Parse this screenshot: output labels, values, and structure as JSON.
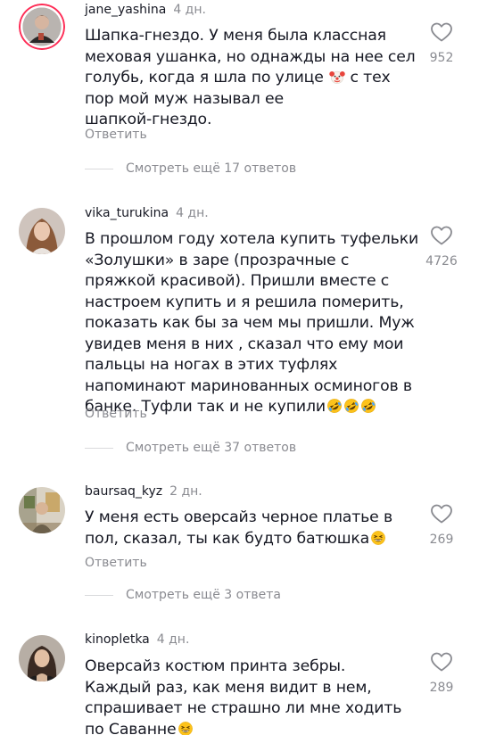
{
  "ui": {
    "reply_label": "Ответить"
  },
  "comments": [
    {
      "username": "jane_yashina",
      "time": "4 дн.",
      "text_lines": [
        "Шапка-гнездо. У меня была классная",
        "меховая ушанка, но однажды на нее сел",
        "голубь, когда я шла по улице",
        "пор мой муж называл ее",
        "шапкой-гнездо."
      ],
      "text_line3_tail": "с тех",
      "likes": "952",
      "more_replies": "Смотреть ещё 17 ответов"
    },
    {
      "username": "vika_turukina",
      "time": "4 дн.",
      "text_lines": [
        "В прошлом году хотела купить туфельки",
        "«Золушки» в заре (прозрачные с",
        "пряжкой красивой). Пришли вместе с",
        "настроем купить и я решила померить,",
        "показать как бы за чем мы пришли. Муж",
        "увидев меня в них , сказал что ему мои",
        "пальцы на ногах в этих туфлях",
        "напоминают маринованных осминогов в",
        "банке. Туфли так и не купили"
      ],
      "likes": "4726",
      "more_replies": "Смотреть ещё 37 ответов"
    },
    {
      "username": "baursaq_kyz",
      "time": "2 дн.",
      "text_lines": [
        "У меня есть оверсайз черное платье в",
        "пол, сказал, ты как будто батюшка"
      ],
      "likes": "269",
      "more_replies": "Смотреть ещё 3 ответа"
    },
    {
      "username": "kinopletka",
      "time": "4 дн.",
      "text_lines": [
        "Оверсайз костюм принта зебры.",
        "Каждый раз, как меня видит в нем,",
        "спрашивает не страшно ли мне ходить",
        "по Саванне"
      ],
      "likes": "289"
    }
  ],
  "icons": {
    "heart": "heart-outline-icon",
    "clown": "clown-face-icon",
    "rofl": "rolling-on-floor-laughing-icon",
    "grin": "grinning-squinting-face-icon"
  },
  "colors": {
    "text": "#161823",
    "secondary": "#8a8b91",
    "separator": "#d9dadc",
    "avatar_ring": "#fe2c55"
  }
}
